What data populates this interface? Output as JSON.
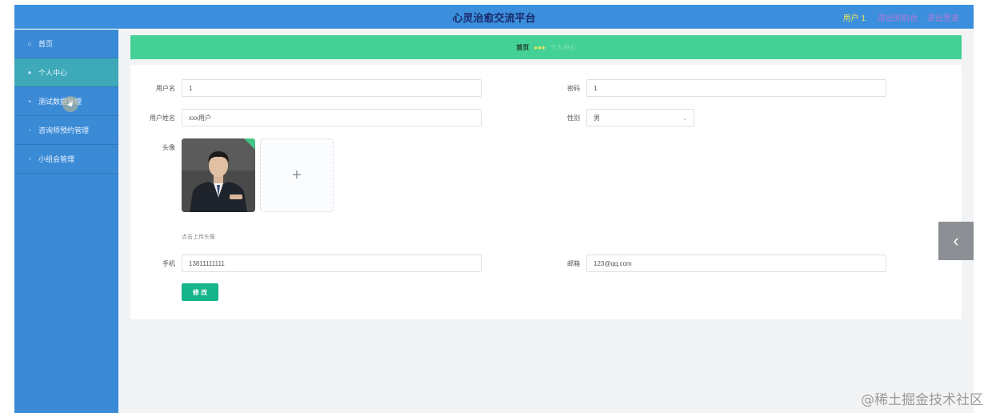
{
  "header": {
    "title": "心灵治愈交流平台",
    "user_label": "用户 1",
    "link_home": "退出到前台",
    "link_logout": "退出登录"
  },
  "sidebar": {
    "items": [
      {
        "label": "首页",
        "icon": "home-icon"
      },
      {
        "label": "个人中心",
        "icon": "person-icon"
      },
      {
        "label": "测试数据管理",
        "icon": "document-icon"
      },
      {
        "label": "咨询师预约管理",
        "icon": "calendar-icon"
      },
      {
        "label": "小组会管理",
        "icon": "group-icon"
      }
    ],
    "active_index": 1
  },
  "breadcrumb": {
    "home": "首页",
    "separator": "●●●",
    "current": "个人中心"
  },
  "form": {
    "username_label": "用户名",
    "username_value": "1",
    "password_label": "密码",
    "password_value": "1",
    "fullname_label": "用户姓名",
    "fullname_value": "xxx用户",
    "gender_label": "性别",
    "gender_value": "男",
    "avatar_label": "头像",
    "upload_plus": "+",
    "upload_hint": "点击上传头像",
    "phone_label": "手机",
    "phone_value": "13811111111",
    "email_label": "邮箱",
    "email_value": "123@qq.com",
    "submit_label": "修 改"
  },
  "collapse_glyph": "‹",
  "watermark": "@稀土掘金技术社区",
  "colors": {
    "topbar": "#3b8fdc",
    "sidebar": "#3a8ad6",
    "sidebar_active": "#3ea9b8",
    "breadcrumb_bar": "#43d196",
    "button": "#15b48a"
  }
}
